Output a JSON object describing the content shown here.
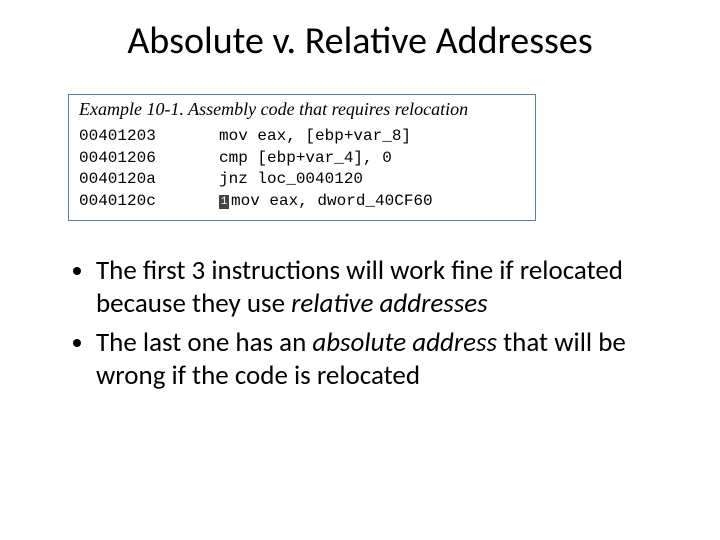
{
  "title": "Absolute v. Relative Addresses",
  "code": {
    "caption": "Example 10-1. Assembly code that requires relocation",
    "lines": [
      {
        "addr": "00401203",
        "instr": "mov eax, [ebp+var_8]",
        "marker": ""
      },
      {
        "addr": "00401206",
        "instr": "cmp [ebp+var_4], 0",
        "marker": ""
      },
      {
        "addr": "0040120a",
        "instr": "jnz loc_0040120",
        "marker": ""
      },
      {
        "addr": "0040120c",
        "instr": "mov eax, dword_40CF60",
        "marker": "1"
      }
    ]
  },
  "bullets": {
    "b1a": "The first 3 instructions will work fine if relocated because they use ",
    "b1b": "relative addresses",
    "b2a": "The last one has an ",
    "b2b": "absolute address",
    "b2c": " that will be wrong if the code is relocated"
  }
}
